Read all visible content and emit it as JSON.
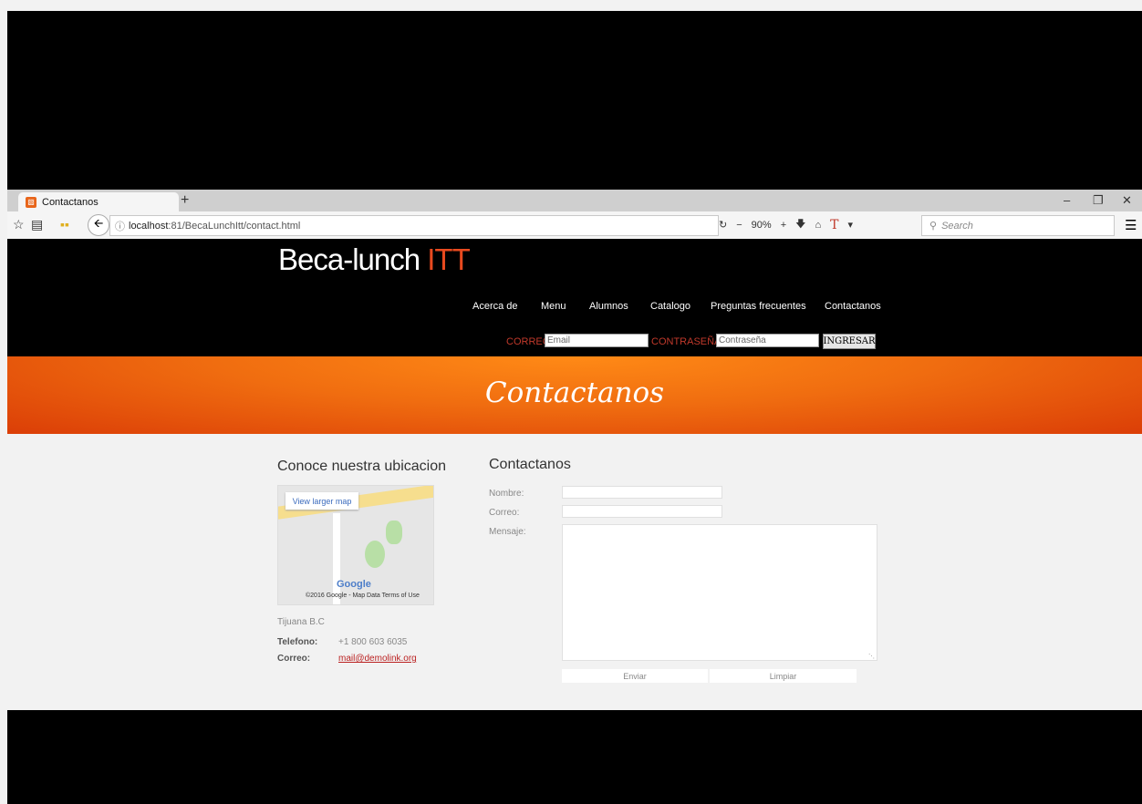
{
  "browser": {
    "tab_title": "Contactanos",
    "new_tab": "+",
    "url_host": "localhost",
    "url_path": ":81/BecaLunchItt/contact.html",
    "zoom_level": "90%",
    "search_placeholder": "Search",
    "icons": [
      "star-icon",
      "reading-list-icon",
      "apps-icon",
      "back-icon",
      "info-icon",
      "reload-icon",
      "zoom-out-icon",
      "zoom-in-icon",
      "download-icon",
      "home-icon",
      "text-t-icon",
      "dropdown-icon",
      "search-icon",
      "menu-icon"
    ]
  },
  "header": {
    "logo_main": "Beca-lunch ",
    "logo_accent": "ITT",
    "nav": [
      "Acerca de",
      "Menu",
      "Alumnos",
      "Catalogo",
      "Preguntas frecuentes",
      "Contactanos"
    ],
    "correo_label": "CORREO",
    "email_placeholder": "Email",
    "password_label": "CONTRASEÑA",
    "password_placeholder": "Contraseña",
    "login_button": "INGRESAR"
  },
  "banner": {
    "title": "Contactanos"
  },
  "location": {
    "heading": "Conoce nuestra ubicacion",
    "map_link": "View larger map",
    "map_logo": "Google",
    "map_copyright": "©2016 Google - Map Data   Terms of Use",
    "city": "Tijuana B.C",
    "phone_label": "Telefono:",
    "phone_value": "+1 800 603 6035",
    "email_label": "Correo:",
    "email_value": "mail@demolink.org"
  },
  "contact_form": {
    "heading": "Contactanos",
    "name_label": "Nombre:",
    "email_label": "Correo:",
    "message_label": "Mensaje:",
    "send_button": "Enviar",
    "clear_button": "Limpiar"
  },
  "colors": {
    "accent": "#e84a1f",
    "banner_orange": "#f06d10",
    "label_red": "#c0392b"
  }
}
